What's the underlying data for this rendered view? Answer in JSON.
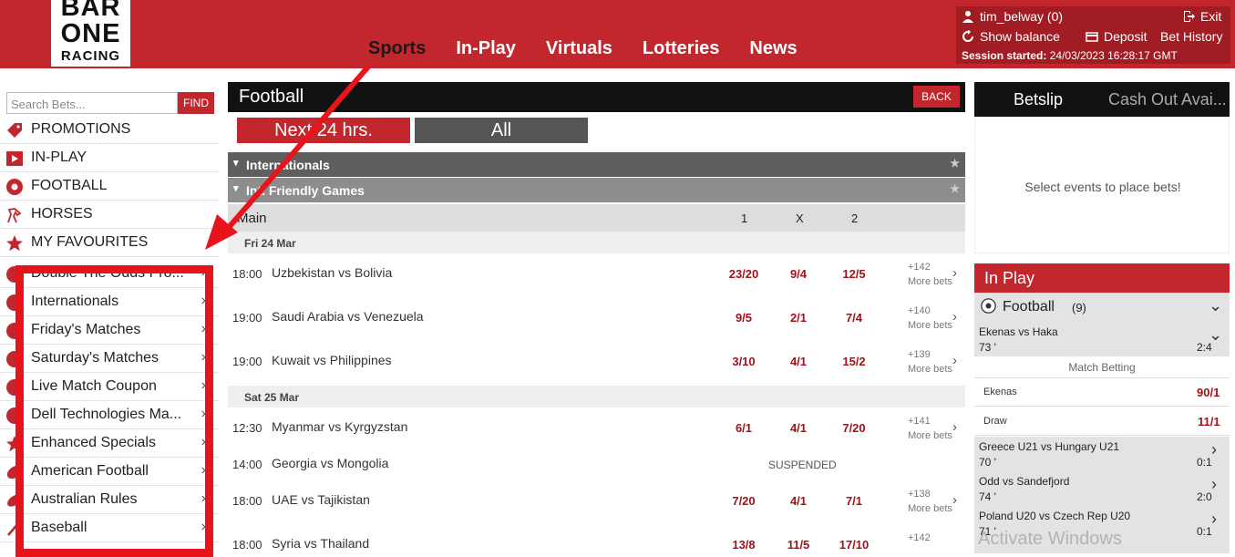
{
  "logo": {
    "line1": "BAR",
    "line2": "ONE",
    "line3": "RACING"
  },
  "nav": [
    {
      "label": "Sports",
      "active": true
    },
    {
      "label": "In-Play"
    },
    {
      "label": "Virtuals"
    },
    {
      "label": "Lotteries"
    },
    {
      "label": "News"
    }
  ],
  "account": {
    "user": "tim_belway (0)",
    "exit": "Exit",
    "show_balance": "Show balance",
    "deposit": "Deposit",
    "bet_history": "Bet History",
    "session_label": "Session started:",
    "session_value": "24/03/2023 16:28:17 GMT"
  },
  "search": {
    "placeholder": "Search Bets...",
    "find": "FIND"
  },
  "sidebar": [
    {
      "label": "PROMOTIONS",
      "icon": "tag-icon"
    },
    {
      "label": "IN-PLAY",
      "icon": "play-icon"
    },
    {
      "label": "FOOTBALL",
      "icon": "football-icon"
    },
    {
      "label": "HORSES",
      "icon": "horse-icon"
    },
    {
      "label": "MY FAVOURITES",
      "icon": "star-icon"
    }
  ],
  "subsports": [
    "Double The Odds Pro...",
    "Internationals",
    "Friday's Matches",
    "Saturday's Matches",
    "Live Match Coupon",
    "Dell Technologies Ma...",
    "Enhanced Specials",
    "American Football",
    "Australian Rules",
    "Baseball"
  ],
  "center": {
    "title": "Football",
    "back": "BACK",
    "tab_next": "Next 24 hrs.",
    "tab_all": "All",
    "section1": "Internationals",
    "section2": "Int. Friendly Games",
    "main_label": "Main",
    "col1": "1",
    "colx": "X",
    "col2": "2",
    "suspended": "SUSPENDED",
    "more_bets": "More bets"
  },
  "dates": [
    "Fri 24 Mar",
    "Sat 25 Mar"
  ],
  "matches": [
    {
      "time": "18:00",
      "name": "Uzbekistan vs Bolivia",
      "o1": "23/20",
      "ox": "9/4",
      "o2": "12/5",
      "more": "+142"
    },
    {
      "time": "19:00",
      "name": "Saudi Arabia vs Venezuela",
      "o1": "9/5",
      "ox": "2/1",
      "o2": "7/4",
      "more": "+140"
    },
    {
      "time": "19:00",
      "name": "Kuwait vs Philippines",
      "o1": "3/10",
      "ox": "4/1",
      "o2": "15/2",
      "more": "+139"
    },
    {
      "time": "12:30",
      "name": "Myanmar vs Kyrgyzstan",
      "o1": "6/1",
      "ox": "4/1",
      "o2": "7/20",
      "more": "+141"
    },
    {
      "time": "14:00",
      "name": "Georgia vs Mongolia",
      "o1": "",
      "ox": "",
      "o2": "",
      "more": ""
    },
    {
      "time": "18:00",
      "name": "UAE vs Tajikistan",
      "o1": "7/20",
      "ox": "4/1",
      "o2": "7/1",
      "more": "+138"
    },
    {
      "time": "18:00",
      "name": "Syria vs Thailand",
      "o1": "13/8",
      "ox": "11/5",
      "o2": "17/10",
      "more": "+142"
    }
  ],
  "betslip": {
    "tab1": "Betslip",
    "tab2": "Cash Out Avai...",
    "empty": "Select events to place bets!"
  },
  "inplay": {
    "title": "In Play",
    "sport": "Football",
    "count": "(9)",
    "first_match": "Ekenas vs Haka",
    "first_min": "73 '",
    "first_score": "2:4",
    "market": "Match Betting",
    "sel1": "Ekenas",
    "sel1_odds": "90/1",
    "sel2": "Draw",
    "sel2_odds": "11/1",
    "m2": "Greece U21 vs Hungary U21",
    "m2_min": "70 '",
    "m2_score": "0:1",
    "m3": "Odd vs Sandefjord",
    "m3_min": "74 '",
    "m3_score": "2:0",
    "m4": "Poland U20 vs Czech Rep U20",
    "m4_min": "71 '",
    "m4_score": "0:1"
  },
  "watermark": "Activate Windows",
  "colors": {
    "brand_red": "#c1272d",
    "annotation_red": "#e8141b",
    "odds_red": "#a0131a"
  }
}
